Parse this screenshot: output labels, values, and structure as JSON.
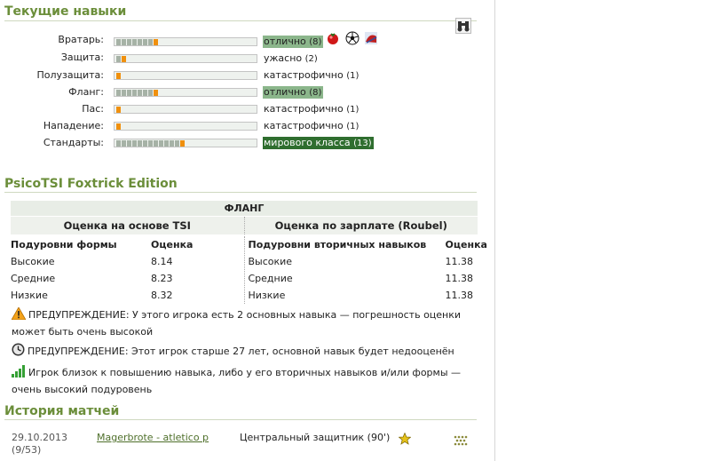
{
  "skills_section": {
    "title": "Текущие навыки",
    "items": [
      {
        "label": "Вратарь:",
        "value": "отлично",
        "level": "(8)",
        "style": "good"
      },
      {
        "label": "Защита:",
        "value": "ужасно",
        "level": "(2)",
        "style": "plain"
      },
      {
        "label": "Полузащита:",
        "value": "катастрофично",
        "level": "(1)",
        "style": "plain"
      },
      {
        "label": "Фланг:",
        "value": "отлично",
        "level": "(8)",
        "style": "good"
      },
      {
        "label": "Пас:",
        "value": "катастрофично",
        "level": "(1)",
        "style": "plain"
      },
      {
        "label": "Нападение:",
        "value": "катастрофично",
        "level": "(1)",
        "style": "plain"
      },
      {
        "label": "Стандарты:",
        "value": "мирового класса",
        "level": "(13)",
        "style": "top"
      }
    ],
    "icons": [
      "tomato-icon",
      "soccer-ball-icon",
      "speed-icon"
    ]
  },
  "psico": {
    "title": "PsicoTSI Foxtrick Edition",
    "position": "ФЛАНГ",
    "left_header": "Оценка на основе TSI",
    "right_header": "Оценка по зарплате (Roubel)",
    "left_col_title": "Подуровни формы",
    "left_col_value": "Оценка",
    "right_col_title": "Подуровни вторичных навыков",
    "right_col_value": "Оценка",
    "left_rows": [
      {
        "label": "Высокие",
        "value": "8.14"
      },
      {
        "label": "Средние",
        "value": "8.23"
      },
      {
        "label": "Низкие",
        "value": "8.32"
      }
    ],
    "right_rows": [
      {
        "label": "Высокие",
        "value": "11.38"
      },
      {
        "label": "Средние",
        "value": "11.38"
      },
      {
        "label": "Низкие",
        "value": "11.38"
      }
    ],
    "warning1": "ПРЕДУПРЕЖДЕНИЕ: У этого игрока есть 2 основных навыка — погрешность оценки может быть очень высокой",
    "warning2": "ПРЕДУПРЕЖДЕНИЕ: Этот игрок старше 27 лет, основной навык будет недооценён",
    "note": "Игрок близок к повышению навыка, либо у его вторичных навыков и/или формы — очень высокий подуровень"
  },
  "history": {
    "title": "История матчей",
    "match": {
      "date": "29.10.2013",
      "id": "(9/53)",
      "teams": "Magerbrote - atletico p",
      "position": "Центральный защитник (90')"
    }
  },
  "colors": {
    "title_green": "#6b8e3a",
    "good_level": "#8bb68b",
    "top_level": "#2f6e2f",
    "bar_current": "#f0900e"
  }
}
